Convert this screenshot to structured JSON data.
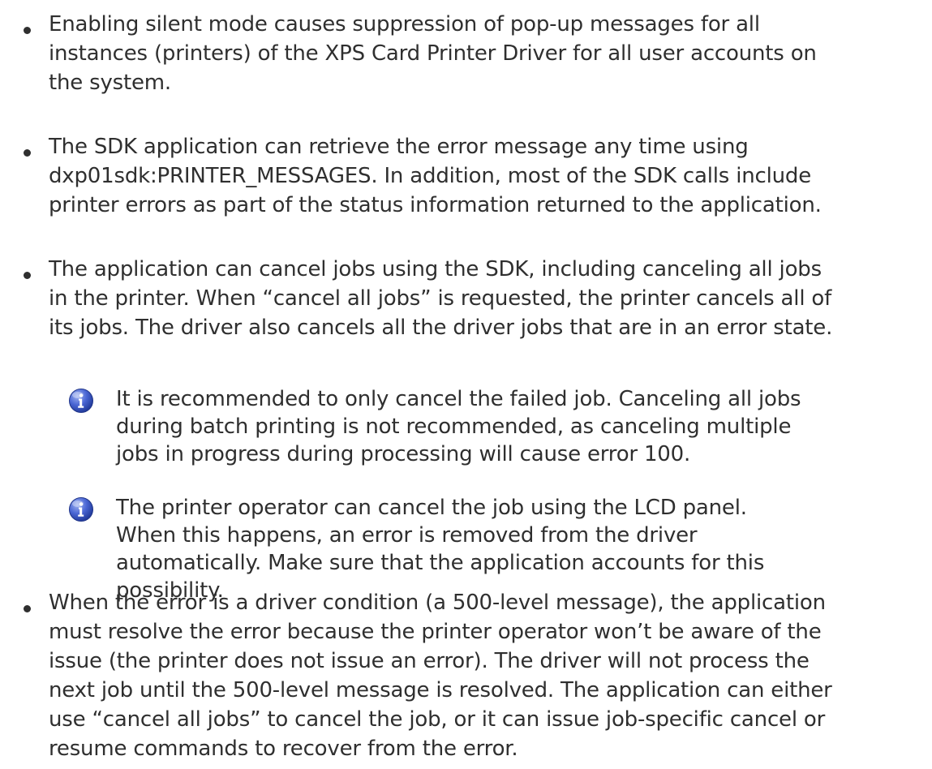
{
  "bullets": [
    {
      "text": "Enabling silent mode causes suppression of pop-up messages for all\ninstances (printers) of the XPS Card Printer Driver for all user accounts on\nthe system."
    },
    {
      "text": "The SDK application can retrieve the error message any time using\ndxp01sdk:PRINTER_MESSAGES. In addition, most of the SDK calls include\nprinter errors as part of the status information returned to the application."
    },
    {
      "text": "The application can cancel jobs using the SDK, including canceling all jobs\nin the printer. When “cancel all jobs” is requested, the printer cancels all of\nits jobs. The driver also cancels all the driver jobs that are in an error state."
    },
    {
      "text": "When the error is a driver condition (a 500-level message), the application\nmust resolve the error because the printer operator won’t be aware of the\nissue (the printer does not issue an error). The driver will not process the\nnext job until the 500-level message is resolved. The application can either\nuse “cancel all jobs” to cancel the job, or it can issue job-specific cancel or\nresume commands to recover from the error."
    }
  ],
  "notes": [
    {
      "icon": "info-icon",
      "text": "It is recommended to only cancel the failed job. Canceling all jobs\nduring batch printing is not recommended, as canceling multiple\njobs in progress during processing will cause error 100."
    },
    {
      "icon": "info-icon",
      "text": "The printer operator can cancel the job using the LCD panel.\nWhen this happens, an error is removed from the driver\nautomatically. Make sure that the application accounts for this\npossibility."
    }
  ],
  "colors": {
    "text": "#2f2f2f",
    "info_icon_fill": "#3a57c4",
    "info_icon_highlight": "#9fb2f0"
  }
}
